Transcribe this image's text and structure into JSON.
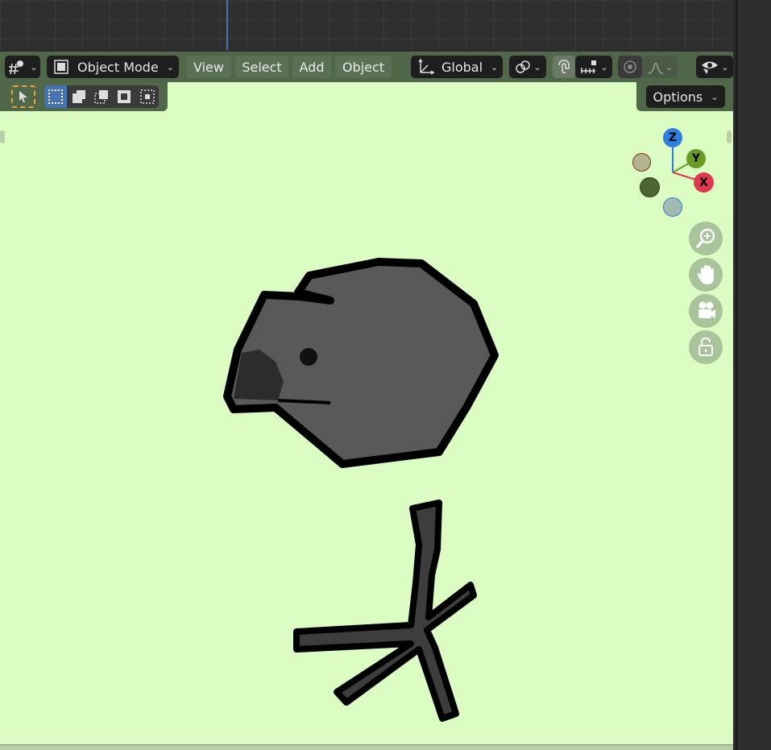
{
  "header": {
    "mode_label": "Object Mode",
    "menus": [
      "View",
      "Select",
      "Add",
      "Object"
    ],
    "transform_orientation": "Global"
  },
  "toolbar": {
    "options_label": "Options"
  },
  "gizmo": {
    "axes": {
      "z": "Z",
      "y": "Y",
      "x": "X"
    }
  },
  "colors": {
    "viewport_bg": "#dbfcc2",
    "header_bg": "#50674a",
    "axis_x": "#e0384c",
    "axis_y": "#6a9a23",
    "axis_z": "#2f7fe0",
    "bird_body": "#595959",
    "bird_outline": "#000000"
  },
  "icons": [
    "editor-type-icon",
    "object-mode-icon",
    "transform-orientation-icon",
    "pivot-link-icon",
    "snap-magnet-icon",
    "snap-increment-icon",
    "proportional-edit-icon",
    "falloff-curve-icon",
    "visibility-eye-icon",
    "select-tool-icon",
    "zoom-icon",
    "pan-hand-icon",
    "camera-icon",
    "lock-icon"
  ]
}
